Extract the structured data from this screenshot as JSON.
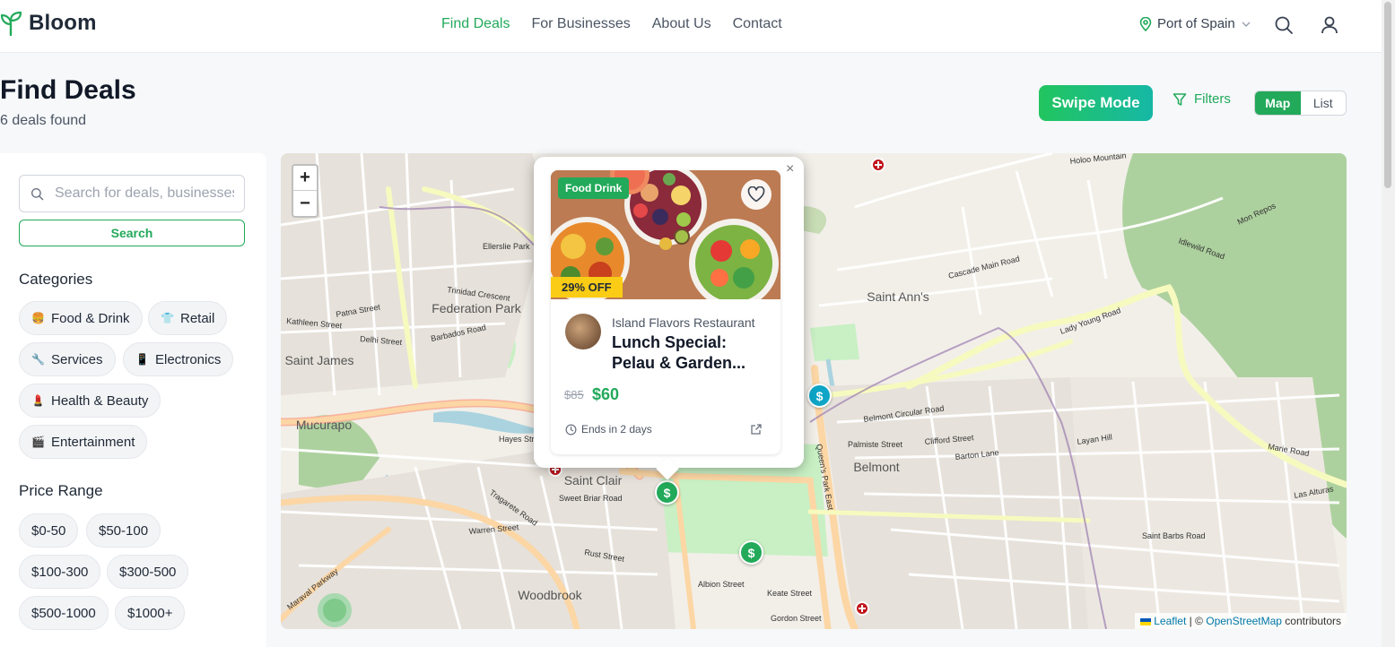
{
  "header": {
    "logo_text": "Bloom",
    "nav": [
      "Find Deals",
      "For Businesses",
      "About Us",
      "Contact"
    ],
    "active_nav": "Find Deals",
    "location": "Port of Spain"
  },
  "page": {
    "title": "Find Deals",
    "deal_count": "6 deals found",
    "swipe_mode": "Swipe Mode",
    "filters": "Filters",
    "view_map": "Map",
    "view_list": "List",
    "active_view": "Map"
  },
  "sidebar": {
    "search_placeholder": "Search for deals, businesses...",
    "search_button": "Search",
    "categories_title": "Categories",
    "categories": [
      {
        "label": "Food & Drink",
        "icon": "burger-icon"
      },
      {
        "label": "Retail",
        "icon": "shirt-icon"
      },
      {
        "label": "Services",
        "icon": "wrench-icon"
      },
      {
        "label": "Electronics",
        "icon": "phone-icon"
      },
      {
        "label": "Health & Beauty",
        "icon": "lipstick-icon"
      },
      {
        "label": "Entertainment",
        "icon": "clapper-icon"
      }
    ],
    "price_title": "Price Range",
    "prices": [
      "$0-50",
      "$50-100",
      "$100-300",
      "$300-500",
      "$500-1000",
      "$1000+"
    ]
  },
  "map": {
    "zoom_in": "+",
    "zoom_out": "−",
    "attribution_leaflet": "Leaflet",
    "attribution_sep": " | © ",
    "attribution_osm": "OpenStreetMap",
    "attribution_tail": " contributors",
    "labels": {
      "federation_park": "Federation Park",
      "saint_james": "Saint James",
      "mucurapo": "Mucurapo",
      "saint_clair": "Saint Clair",
      "woodbrook": "Woodbrook",
      "saint_anns": "Saint Ann's",
      "belmont": "Belmont",
      "lady_young_road": "Lady Young Road",
      "belmont_circular_road": "Belmont Circular Road",
      "cascade_main_road": "Cascade Main Road",
      "queens_park_east": "Queen's Park East",
      "tragarete_road": "Tragarete Road",
      "maraval_parkway": "Maraval Parkway",
      "saint_barbs_road": "Saint Barbs Road",
      "marie_road": "Marie Road",
      "idlewild_road": "Idlewild Road",
      "mon_repos": "Mon Repos",
      "warren_street": "Warren Street",
      "patna_street": "Patna Street",
      "delhi_street": "Delhi Street",
      "barbados_road": "Barbados Road",
      "kathleen_street": "Kathleen Street",
      "hayes_street": "Hayes Street",
      "sweet_briar_road": "Sweet Briar Road",
      "rust_street": "Rust Street",
      "gordon_street": "Gordon Street",
      "keate_street": "Keate Street",
      "albion_street": "Albion Street",
      "clifford_street": "Clifford Street",
      "layan_hill": "Layan Hill",
      "barton_lane": "Barton Lane",
      "palmiste_street": "Palmiste Street",
      "ellerslie_park": "Ellerslie Park",
      "trinidad_crescent": "Trinidad Crescent",
      "las_alturas": "Las Alturas",
      "holoo_mountain": "Holoo Mountain"
    }
  },
  "popup": {
    "close": "×",
    "category_badge": "Food Drink",
    "discount": "29% OFF",
    "business": "Island Flavors Restaurant",
    "title": "Lunch Special: Pelau & Garden...",
    "old_price": "$85",
    "new_price": "$60",
    "ends": "Ends in 2 days"
  },
  "pins": [
    {
      "symbol": "$",
      "color": "#22a95a"
    },
    {
      "symbol": "$",
      "color": "#22a95a"
    },
    {
      "symbol": "$",
      "color": "#0ea5c6"
    }
  ],
  "colors": {
    "accent": "#22a95a",
    "discount": "#facc15",
    "pin_teal": "#0ea5c6",
    "hospital": "#c0141b"
  }
}
